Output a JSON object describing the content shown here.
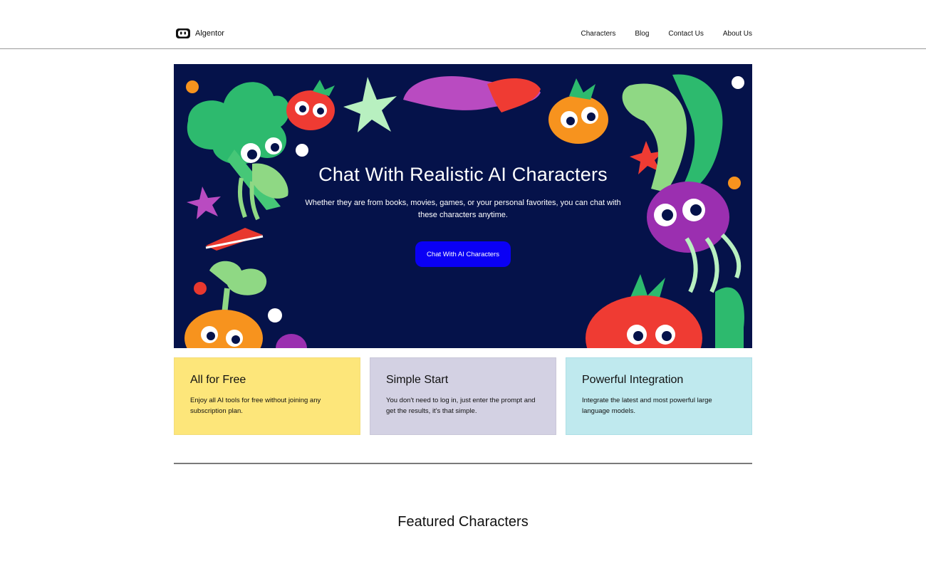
{
  "header": {
    "logo_text": "Algentor",
    "nav": [
      "Characters",
      "Blog",
      "Contact Us",
      "About Us"
    ]
  },
  "hero": {
    "title": "Chat With Realistic AI Characters",
    "subtitle": "Whether they are from books, movies, games, or your personal favorites, you can chat with these characters anytime.",
    "cta_label": "Chat With AI Characters"
  },
  "features": [
    {
      "title": "All for Free",
      "text": "Enjoy all AI tools for free without joining any subscription plan."
    },
    {
      "title": "Simple Start",
      "text": "You don't need to log in, just enter the prompt and get the results, it's that simple."
    },
    {
      "title": "Powerful Integration",
      "text": "Integrate the latest and most powerful large language models."
    }
  ],
  "featured": {
    "title": "Featured Characters"
  },
  "colors": {
    "hero_bg": "#05124a",
    "cta": "#0a00f5",
    "card_free": "#fde67a",
    "card_simple": "#d3d1e3",
    "card_integration": "#bfe9ee"
  },
  "icons": {
    "logo": "robot-face-icon"
  }
}
